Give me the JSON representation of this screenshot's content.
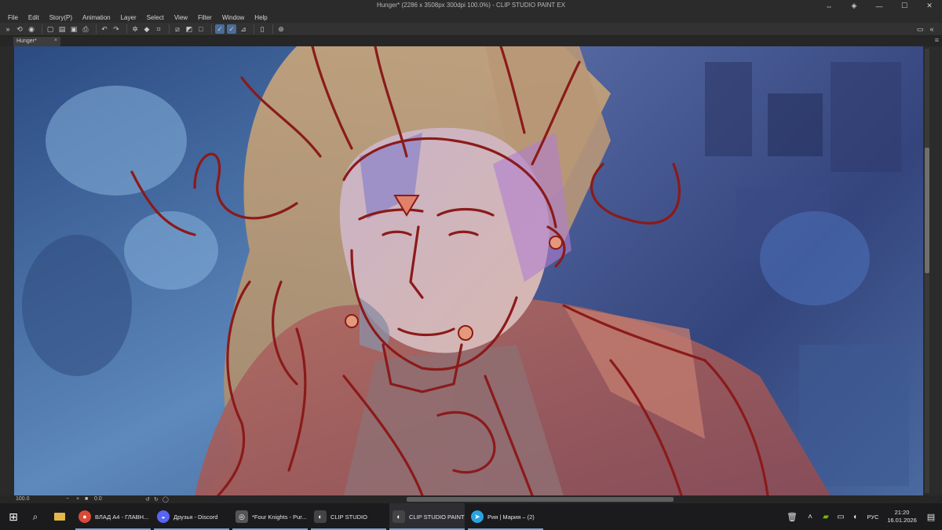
{
  "window": {
    "title": "Hunger* (2286 x 3508px 300dpi 100.0%)  - CLIP STUDIO PAINT EX",
    "buttons": [
      "restore-panels",
      "screen-mode",
      "minimize",
      "maximize",
      "close"
    ]
  },
  "menu": [
    "File",
    "Edit",
    "Story(P)",
    "Animation",
    "Layer",
    "Select",
    "View",
    "Filter",
    "Window",
    "Help"
  ],
  "toolbar": {
    "icons": [
      "expand",
      "sync",
      "eye",
      "new",
      "open",
      "save",
      "print",
      "undo",
      "redo",
      "transform",
      "fill",
      "crop",
      "clear",
      "fill-layer",
      "border",
      "draw-mode-1",
      "draw-mode-2",
      "ruler",
      "device",
      "help"
    ]
  },
  "canvas_tab": {
    "label": "Hunger*",
    "close_icon": "×"
  },
  "status": {
    "zoom": "100.0",
    "minus": "−",
    "plus": "+",
    "angle": "0.0"
  },
  "taskbar": {
    "items": [
      {
        "label": "ВЛАД А4 - ГЛАВН...",
        "icon": "chrome",
        "color": "#d94a38",
        "active": false
      },
      {
        "label": "Друзья - Discord",
        "icon": "discord",
        "color": "#5865f2",
        "active": false
      },
      {
        "label": "*Four Knights - Pur...",
        "icon": "app",
        "color": "#6a6a6a",
        "active": false
      },
      {
        "label": "CLIP STUDIO",
        "icon": "clip",
        "color": "#4a4a4a",
        "active": false
      },
      {
        "label": "CLIP STUDIO PAINT",
        "icon": "clip",
        "color": "#4a4a4a",
        "active": true
      },
      {
        "label": "Рия | Мария – (2)",
        "icon": "telegram",
        "color": "#2aa3e0",
        "active": false
      }
    ],
    "tray": {
      "lang": "РУС",
      "time": "21:20",
      "date": "16.01.2026"
    }
  }
}
